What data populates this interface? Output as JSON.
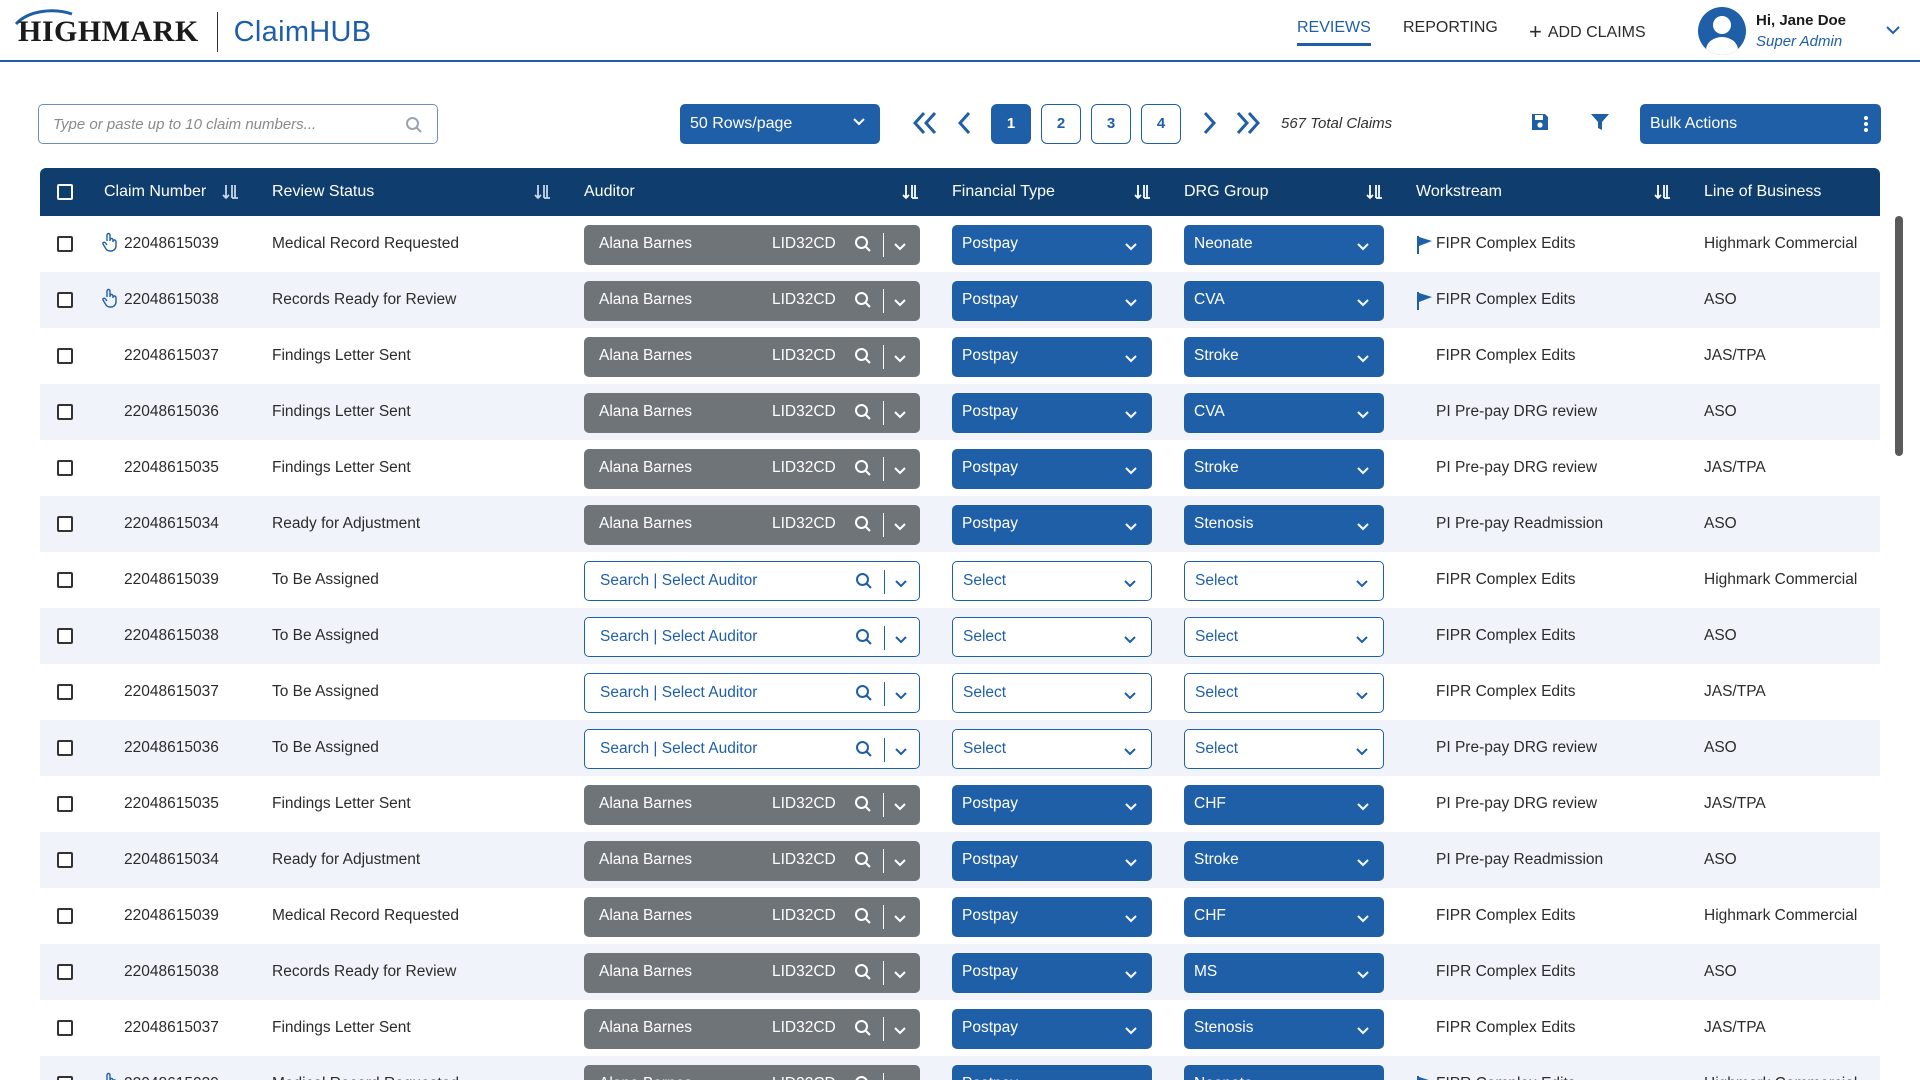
{
  "brand": {
    "logo": "HIGHMARK",
    "app_name": "ClaimHUB",
    "accent": "#1f5fa8",
    "header_dark": "#0f3d6e"
  },
  "nav": {
    "reviews": "REVIEWS",
    "reporting": "REPORTING",
    "add_claims": "ADD CLAIMS"
  },
  "user": {
    "greeting": "Hi, Jane Doe",
    "role": "Super Admin"
  },
  "toolbar": {
    "search_placeholder": "Type or paste up to 10 claim numbers...",
    "rows_per_page": "50 Rows/page",
    "pages": [
      "1",
      "2",
      "3",
      "4"
    ],
    "current_page": "1",
    "total_claims": "567 Total Claims",
    "bulk_actions": "Bulk Actions"
  },
  "columns": {
    "claim_number": "Claim Number",
    "review_status": "Review Status",
    "auditor": "Auditor",
    "financial_type": "Financial Type",
    "drg_group": "DRG Group",
    "workstream": "Workstream",
    "line_of_business": "Line of Business"
  },
  "rows": [
    {
      "claim": "22048615039",
      "status": "Medical Record Requested",
      "auditor": "Alana Barnes",
      "auditor_id": "LID32CD",
      "assigned": true,
      "financial": "Postpay",
      "drg": "Neonate",
      "workstream": "FIPR Complex Edits",
      "lob": "Highmark Commercial",
      "hand": true,
      "flag": true
    },
    {
      "claim": "22048615038",
      "status": "Records Ready for Review",
      "auditor": "Alana Barnes",
      "auditor_id": "LID32CD",
      "assigned": true,
      "financial": "Postpay",
      "drg": "CVA",
      "workstream": "FIPR Complex Edits",
      "lob": "ASO",
      "hand": true,
      "flag": true
    },
    {
      "claim": "22048615037",
      "status": "Findings Letter Sent",
      "auditor": "Alana Barnes",
      "auditor_id": "LID32CD",
      "assigned": true,
      "financial": "Postpay",
      "drg": "Stroke",
      "workstream": "FIPR Complex Edits",
      "lob": "JAS/TPA",
      "hand": false,
      "flag": false
    },
    {
      "claim": "22048615036",
      "status": "Findings Letter Sent",
      "auditor": "Alana Barnes",
      "auditor_id": "LID32CD",
      "assigned": true,
      "financial": "Postpay",
      "drg": "CVA",
      "workstream": "PI Pre-pay DRG review",
      "lob": "ASO",
      "hand": false,
      "flag": false
    },
    {
      "claim": "22048615035",
      "status": "Findings Letter Sent",
      "auditor": "Alana Barnes",
      "auditor_id": "LID32CD",
      "assigned": true,
      "financial": "Postpay",
      "drg": "Stroke",
      "workstream": "PI Pre-pay DRG review",
      "lob": "JAS/TPA",
      "hand": false,
      "flag": false
    },
    {
      "claim": "22048615034",
      "status": "Ready for Adjustment",
      "auditor": "Alana Barnes",
      "auditor_id": "LID32CD",
      "assigned": true,
      "financial": "Postpay",
      "drg": "Stenosis",
      "workstream": "PI Pre-pay Readmission",
      "lob": "ASO",
      "hand": false,
      "flag": false
    },
    {
      "claim": "22048615039",
      "status": "To Be Assigned",
      "auditor": "Search | Select Auditor",
      "auditor_id": "",
      "assigned": false,
      "financial": "Select",
      "drg": "Select",
      "workstream": "FIPR Complex Edits",
      "lob": "Highmark Commercial",
      "hand": false,
      "flag": false
    },
    {
      "claim": "22048615038",
      "status": "To Be Assigned",
      "auditor": "Search | Select Auditor",
      "auditor_id": "",
      "assigned": false,
      "financial": "Select",
      "drg": "Select",
      "workstream": "FIPR Complex Edits",
      "lob": "ASO",
      "hand": false,
      "flag": false
    },
    {
      "claim": "22048615037",
      "status": "To Be Assigned",
      "auditor": "Search | Select Auditor",
      "auditor_id": "",
      "assigned": false,
      "financial": "Select",
      "drg": "Select",
      "workstream": "FIPR Complex Edits",
      "lob": "JAS/TPA",
      "hand": false,
      "flag": false
    },
    {
      "claim": "22048615036",
      "status": "To Be Assigned",
      "auditor": "Search | Select Auditor",
      "auditor_id": "",
      "assigned": false,
      "financial": "Select",
      "drg": "Select",
      "workstream": "PI Pre-pay DRG review",
      "lob": "ASO",
      "hand": false,
      "flag": false
    },
    {
      "claim": "22048615035",
      "status": "Findings Letter Sent",
      "auditor": "Alana Barnes",
      "auditor_id": "LID32CD",
      "assigned": true,
      "financial": "Postpay",
      "drg": "CHF",
      "workstream": "PI Pre-pay DRG review",
      "lob": "JAS/TPA",
      "hand": false,
      "flag": false
    },
    {
      "claim": "22048615034",
      "status": "Ready for Adjustment",
      "auditor": "Alana Barnes",
      "auditor_id": "LID32CD",
      "assigned": true,
      "financial": "Postpay",
      "drg": "Stroke",
      "workstream": "PI Pre-pay Readmission",
      "lob": "ASO",
      "hand": false,
      "flag": false
    },
    {
      "claim": "22048615039",
      "status": "Medical Record Requested",
      "auditor": "Alana Barnes",
      "auditor_id": "LID32CD",
      "assigned": true,
      "financial": "Postpay",
      "drg": "CHF",
      "workstream": "FIPR Complex Edits",
      "lob": "Highmark Commercial",
      "hand": false,
      "flag": false
    },
    {
      "claim": "22048615038",
      "status": "Records Ready for Review",
      "auditor": "Alana Barnes",
      "auditor_id": "LID32CD",
      "assigned": true,
      "financial": "Postpay",
      "drg": "MS",
      "workstream": "FIPR Complex Edits",
      "lob": "ASO",
      "hand": false,
      "flag": false
    },
    {
      "claim": "22048615037",
      "status": "Findings Letter Sent",
      "auditor": "Alana Barnes",
      "auditor_id": "LID32CD",
      "assigned": true,
      "financial": "Postpay",
      "drg": "Stenosis",
      "workstream": "FIPR Complex Edits",
      "lob": "JAS/TPA",
      "hand": false,
      "flag": false
    }
  ]
}
